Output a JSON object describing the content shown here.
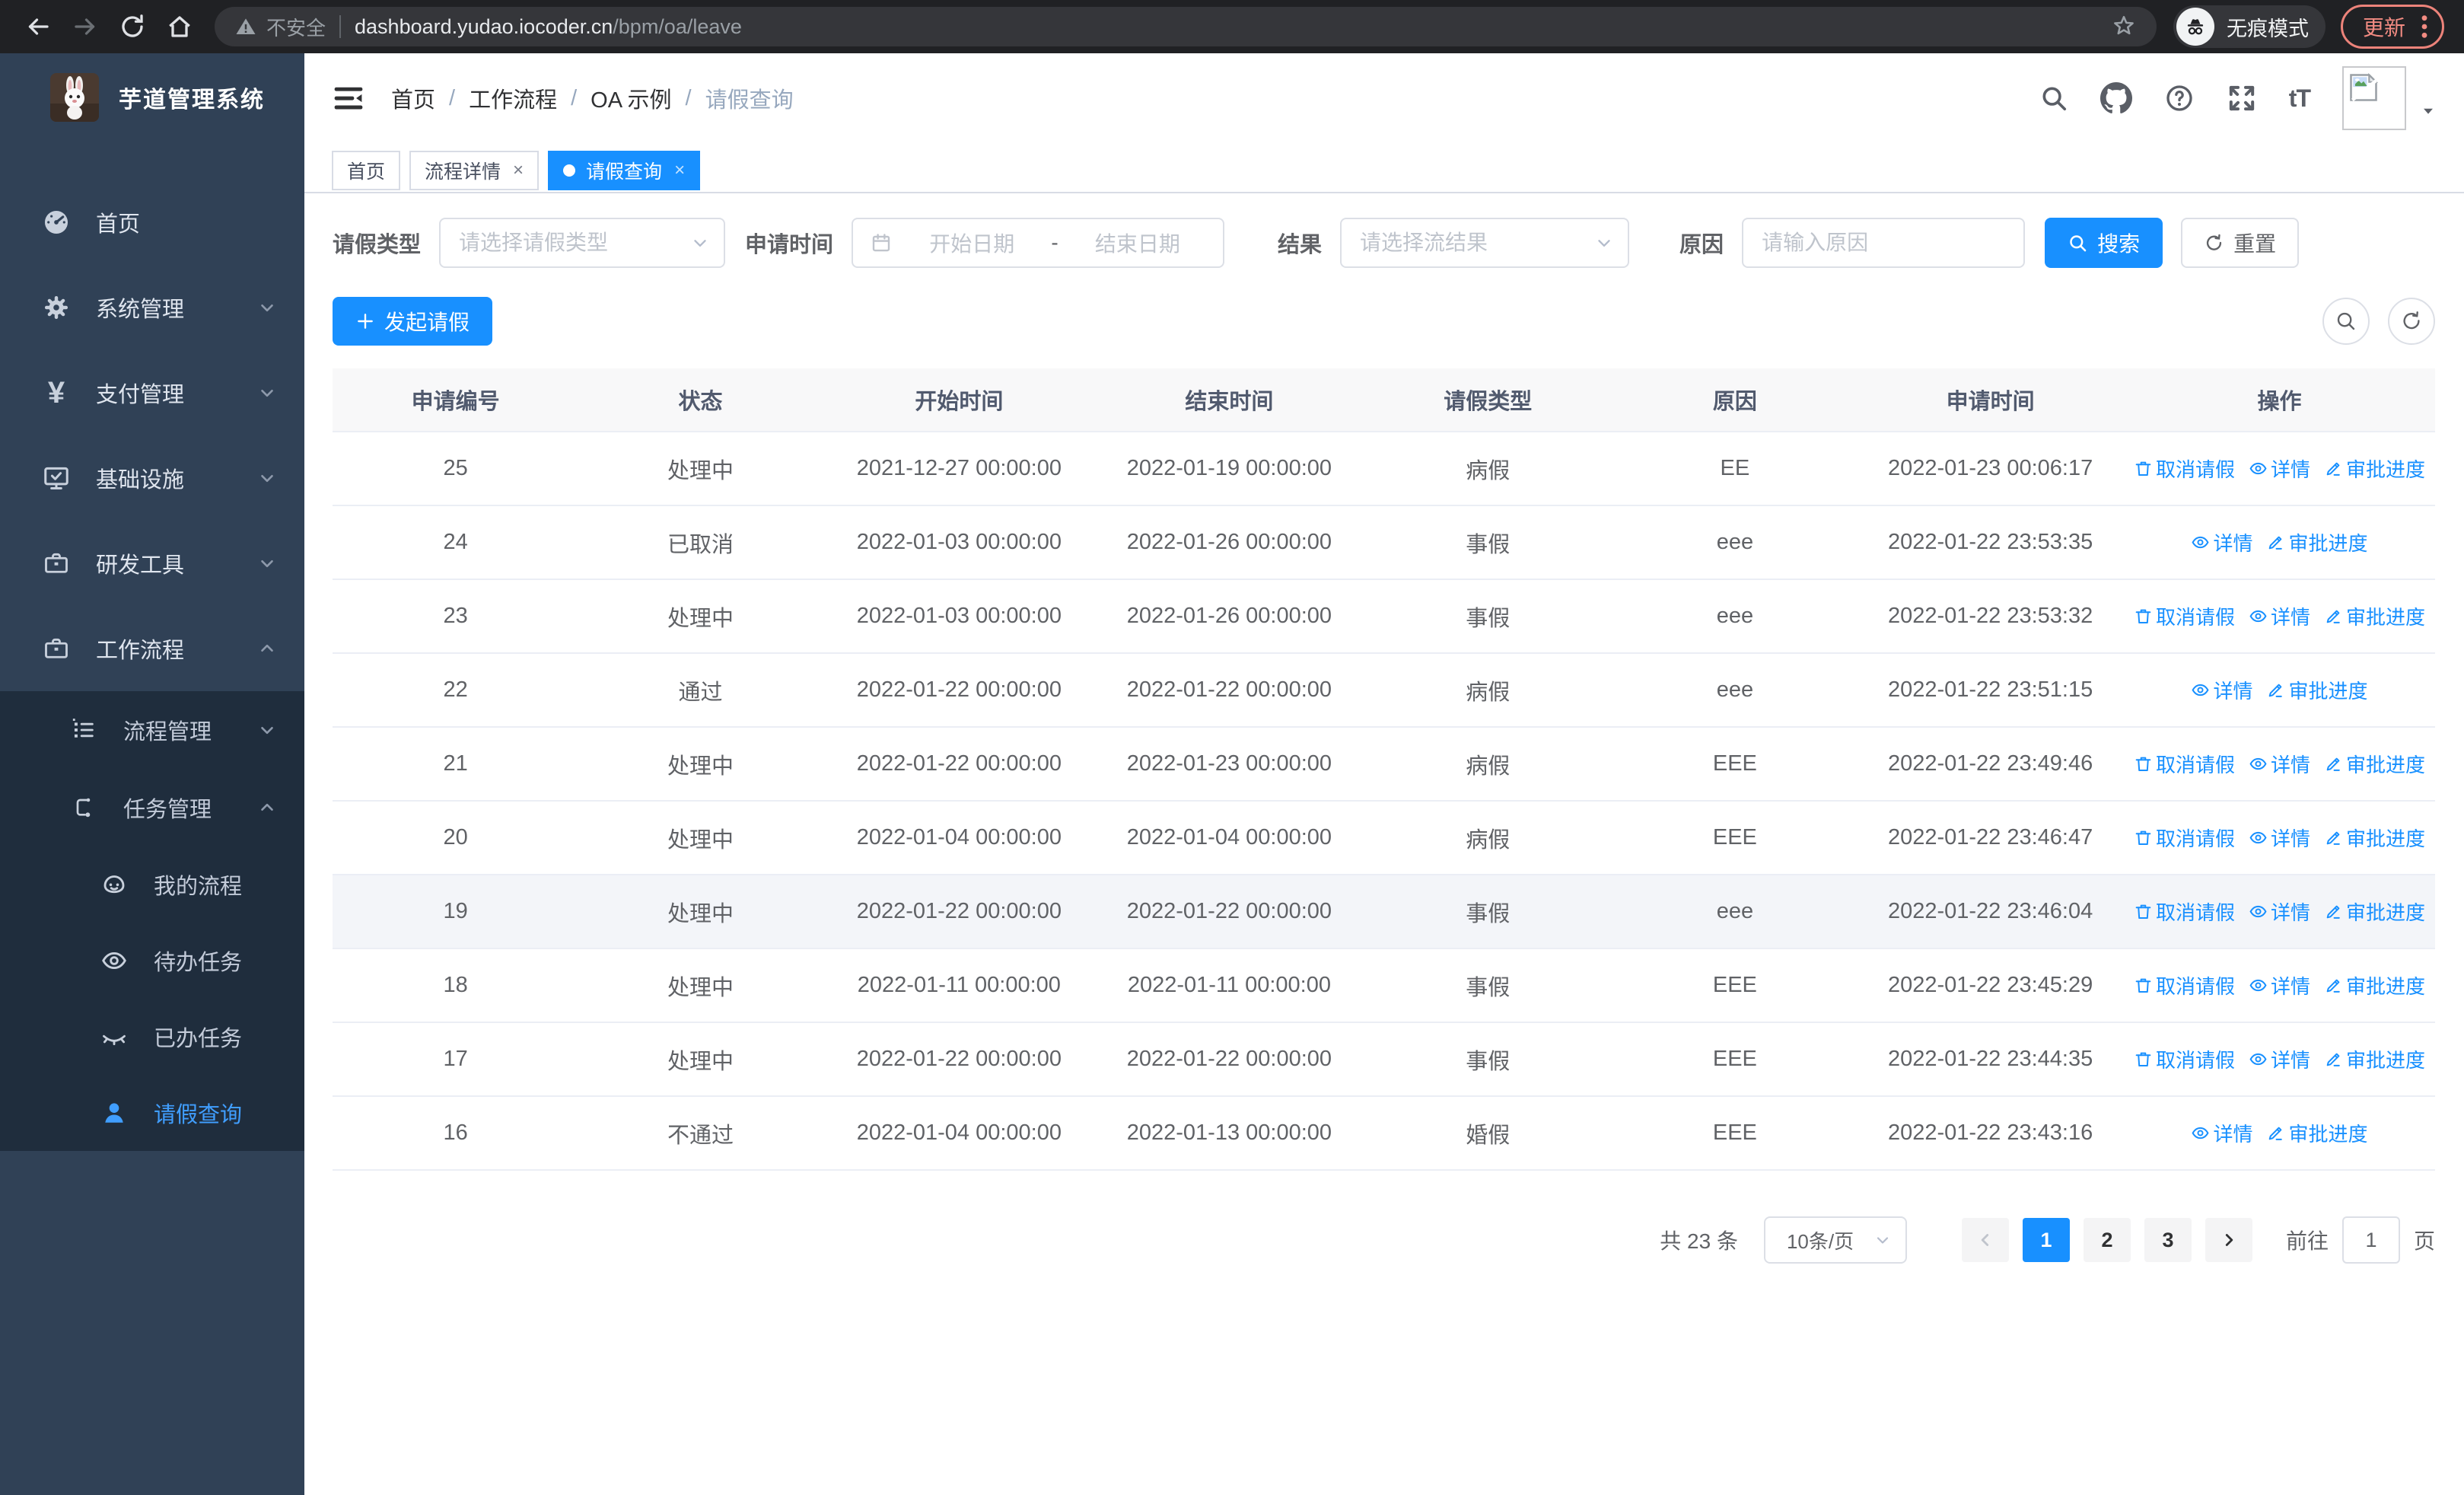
{
  "colors": {
    "accent": "#1890ff",
    "sidebar_bg": "#304156",
    "sidebar_sub_bg": "#1f2d3d",
    "active_menu": "#409eff",
    "update_accent": "#f28b82",
    "table_border": "#ebeef5"
  },
  "browser": {
    "security_label": "不安全",
    "url_host": "dashboard.yudao.iocoder.cn",
    "url_path": "/bpm/oa/leave",
    "incognito_label": "无痕模式",
    "update_label": "更新"
  },
  "sidebar": {
    "title": "芋道管理系统",
    "items": [
      {
        "label": "首页"
      },
      {
        "label": "系统管理"
      },
      {
        "label": "支付管理"
      },
      {
        "label": "基础设施"
      },
      {
        "label": "研发工具"
      },
      {
        "label": "工作流程"
      }
    ],
    "sub_items": [
      {
        "label": "流程管理"
      },
      {
        "label": "任务管理"
      }
    ],
    "task_items": [
      {
        "label": "我的流程"
      },
      {
        "label": "待办任务"
      },
      {
        "label": "已办任务"
      },
      {
        "label": "请假查询"
      }
    ]
  },
  "breadcrumb": {
    "separator": "/",
    "items": [
      "首页",
      "工作流程",
      "OA 示例",
      "请假查询"
    ]
  },
  "tabs": [
    {
      "label": "首页"
    },
    {
      "label": "流程详情"
    },
    {
      "label": "请假查询"
    }
  ],
  "filters": {
    "leave_type_label": "请假类型",
    "leave_type_placeholder": "请选择请假类型",
    "apply_time_label": "申请时间",
    "date_start_placeholder": "开始日期",
    "date_separator": "-",
    "date_end_placeholder": "结束日期",
    "result_label": "结果",
    "result_placeholder": "请选择流结果",
    "reason_label": "原因",
    "reason_placeholder": "请输入原因",
    "search_label": "搜索",
    "reset_label": "重置"
  },
  "toolbar": {
    "create_label": "发起请假"
  },
  "table": {
    "columns": [
      "申请编号",
      "状态",
      "开始时间",
      "结束时间",
      "请假类型",
      "原因",
      "申请时间",
      "操作"
    ],
    "action_defs": {
      "cancel": "取消请假",
      "detail": "详情",
      "progress": "审批进度"
    },
    "rows": [
      {
        "id": "25",
        "status": "处理中",
        "start_time": "2021-12-27 00:00:00",
        "end_time": "2022-01-19 00:00:00",
        "leave_type": "病假",
        "reason": "EE",
        "apply_time": "2022-01-23 00:06:17",
        "actions": [
          "cancel",
          "detail",
          "progress"
        ],
        "highlighted": false
      },
      {
        "id": "24",
        "status": "已取消",
        "start_time": "2022-01-03 00:00:00",
        "end_time": "2022-01-26 00:00:00",
        "leave_type": "事假",
        "reason": "eee",
        "apply_time": "2022-01-22 23:53:35",
        "actions": [
          "detail",
          "progress"
        ],
        "highlighted": false
      },
      {
        "id": "23",
        "status": "处理中",
        "start_time": "2022-01-03 00:00:00",
        "end_time": "2022-01-26 00:00:00",
        "leave_type": "事假",
        "reason": "eee",
        "apply_time": "2022-01-22 23:53:32",
        "actions": [
          "cancel",
          "detail",
          "progress"
        ],
        "highlighted": false
      },
      {
        "id": "22",
        "status": "通过",
        "start_time": "2022-01-22 00:00:00",
        "end_time": "2022-01-22 00:00:00",
        "leave_type": "病假",
        "reason": "eee",
        "apply_time": "2022-01-22 23:51:15",
        "actions": [
          "detail",
          "progress"
        ],
        "highlighted": false
      },
      {
        "id": "21",
        "status": "处理中",
        "start_time": "2022-01-22 00:00:00",
        "end_time": "2022-01-23 00:00:00",
        "leave_type": "病假",
        "reason": "EEE",
        "apply_time": "2022-01-22 23:49:46",
        "actions": [
          "cancel",
          "detail",
          "progress"
        ],
        "highlighted": false
      },
      {
        "id": "20",
        "status": "处理中",
        "start_time": "2022-01-04 00:00:00",
        "end_time": "2022-01-04 00:00:00",
        "leave_type": "病假",
        "reason": "EEE",
        "apply_time": "2022-01-22 23:46:47",
        "actions": [
          "cancel",
          "detail",
          "progress"
        ],
        "highlighted": false
      },
      {
        "id": "19",
        "status": "处理中",
        "start_time": "2022-01-22 00:00:00",
        "end_time": "2022-01-22 00:00:00",
        "leave_type": "事假",
        "reason": "eee",
        "apply_time": "2022-01-22 23:46:04",
        "actions": [
          "cancel",
          "detail",
          "progress"
        ],
        "highlighted": true
      },
      {
        "id": "18",
        "status": "处理中",
        "start_time": "2022-01-11 00:00:00",
        "end_time": "2022-01-11 00:00:00",
        "leave_type": "事假",
        "reason": "EEE",
        "apply_time": "2022-01-22 23:45:29",
        "actions": [
          "cancel",
          "detail",
          "progress"
        ],
        "highlighted": false
      },
      {
        "id": "17",
        "status": "处理中",
        "start_time": "2022-01-22 00:00:00",
        "end_time": "2022-01-22 00:00:00",
        "leave_type": "事假",
        "reason": "EEE",
        "apply_time": "2022-01-22 23:44:35",
        "actions": [
          "cancel",
          "detail",
          "progress"
        ],
        "highlighted": false
      },
      {
        "id": "16",
        "status": "不通过",
        "start_time": "2022-01-04 00:00:00",
        "end_time": "2022-01-13 00:00:00",
        "leave_type": "婚假",
        "reason": "EEE",
        "apply_time": "2022-01-22 23:43:16",
        "actions": [
          "detail",
          "progress"
        ],
        "highlighted": false
      }
    ]
  },
  "pagination": {
    "total_text": "共 23 条",
    "page_size_label": "10条/页",
    "pages": [
      "1",
      "2",
      "3"
    ],
    "current_page": "1",
    "goto_label": "前往",
    "goto_value": "1",
    "page_unit": "页"
  }
}
